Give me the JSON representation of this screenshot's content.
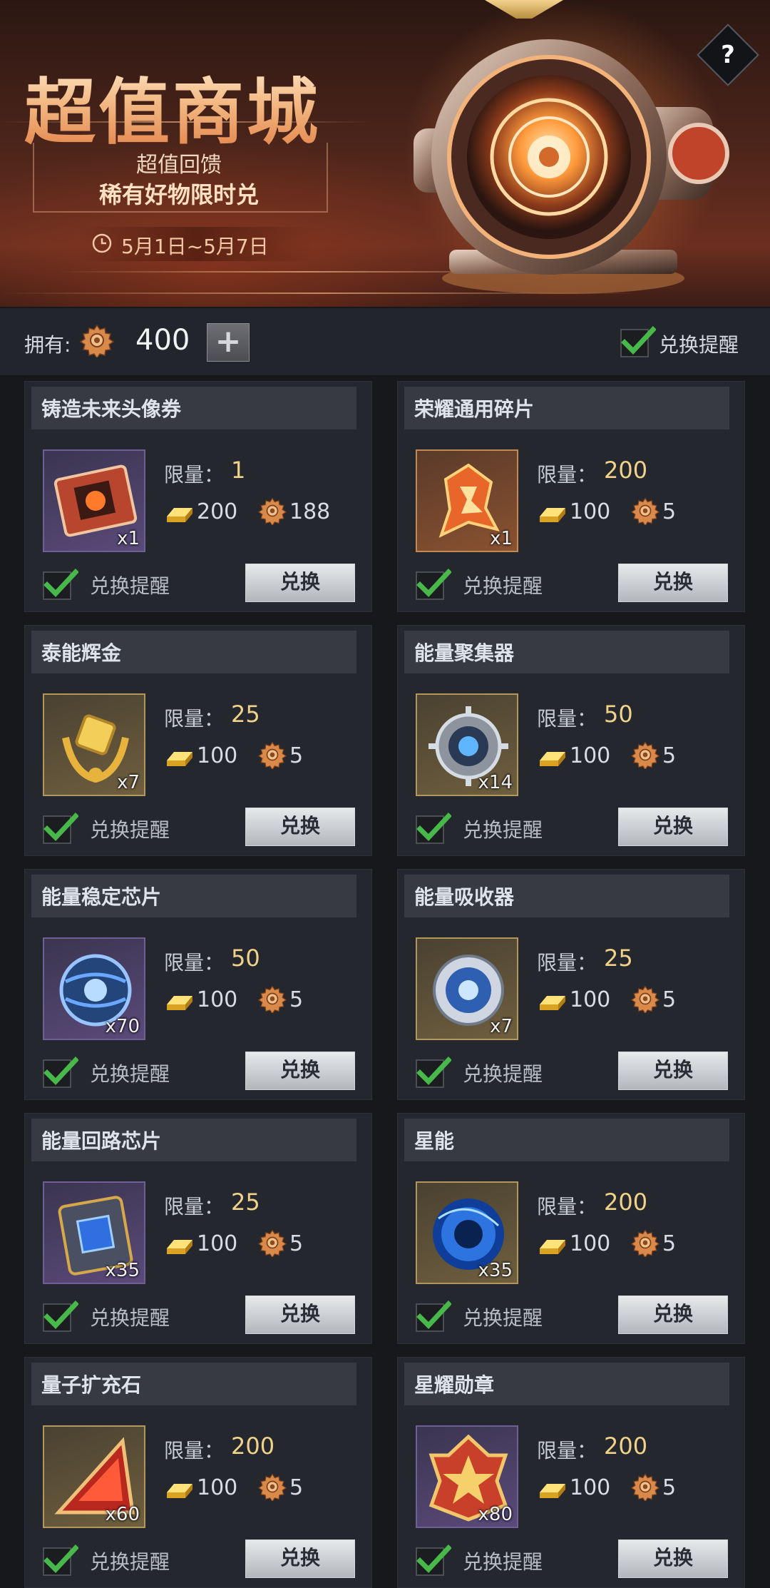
{
  "banner": {
    "title": "超值商城",
    "subtitle1": "超值回馈",
    "subtitle2": "稀有好物限时兑",
    "date_range": "5月1日~5月7日",
    "help_label": "?"
  },
  "currency": {
    "own_label": "拥有:",
    "amount": "400",
    "add_label": "+",
    "remind_label": "兑换提醒",
    "remind_checked": true
  },
  "labels": {
    "limit": "限量：",
    "remind": "兑换提醒",
    "exchange": "兑换"
  },
  "items": [
    {
      "name": "铸造未来头像券",
      "limit": "1",
      "gold": "200",
      "gear": "188",
      "qty": "x1",
      "frame": "purple",
      "icon": "ticket-icon"
    },
    {
      "name": "荣耀通用碎片",
      "limit": "200",
      "gold": "100",
      "gear": "5",
      "qty": "x1",
      "frame": "orange",
      "icon": "fragment-icon"
    },
    {
      "name": "泰能辉金",
      "limit": "25",
      "gold": "100",
      "gear": "5",
      "qty": "x7",
      "frame": "gold",
      "icon": "gold-laurel-icon"
    },
    {
      "name": "能量聚集器",
      "limit": "50",
      "gold": "100",
      "gear": "5",
      "qty": "x14",
      "frame": "gold",
      "icon": "energy-gatherer-icon"
    },
    {
      "name": "能量稳定芯片",
      "limit": "50",
      "gold": "100",
      "gear": "5",
      "qty": "x70",
      "frame": "purple",
      "icon": "energy-sphere-icon"
    },
    {
      "name": "能量吸收器",
      "limit": "25",
      "gold": "100",
      "gear": "5",
      "qty": "x7",
      "frame": "gold",
      "icon": "energy-absorber-icon"
    },
    {
      "name": "能量回路芯片",
      "limit": "25",
      "gold": "100",
      "gear": "5",
      "qty": "x35",
      "frame": "purple",
      "icon": "circuit-chip-icon"
    },
    {
      "name": "星能",
      "limit": "200",
      "gold": "100",
      "gear": "5",
      "qty": "x35",
      "frame": "gold",
      "icon": "star-energy-orb-icon"
    },
    {
      "name": "量子扩充石",
      "limit": "200",
      "gold": "100",
      "gear": "5",
      "qty": "x60",
      "frame": "gold",
      "icon": "quantum-stone-icon"
    },
    {
      "name": "星耀勋章",
      "limit": "200",
      "gold": "100",
      "gear": "5",
      "qty": "x80",
      "frame": "purple",
      "icon": "star-medal-icon"
    }
  ]
}
